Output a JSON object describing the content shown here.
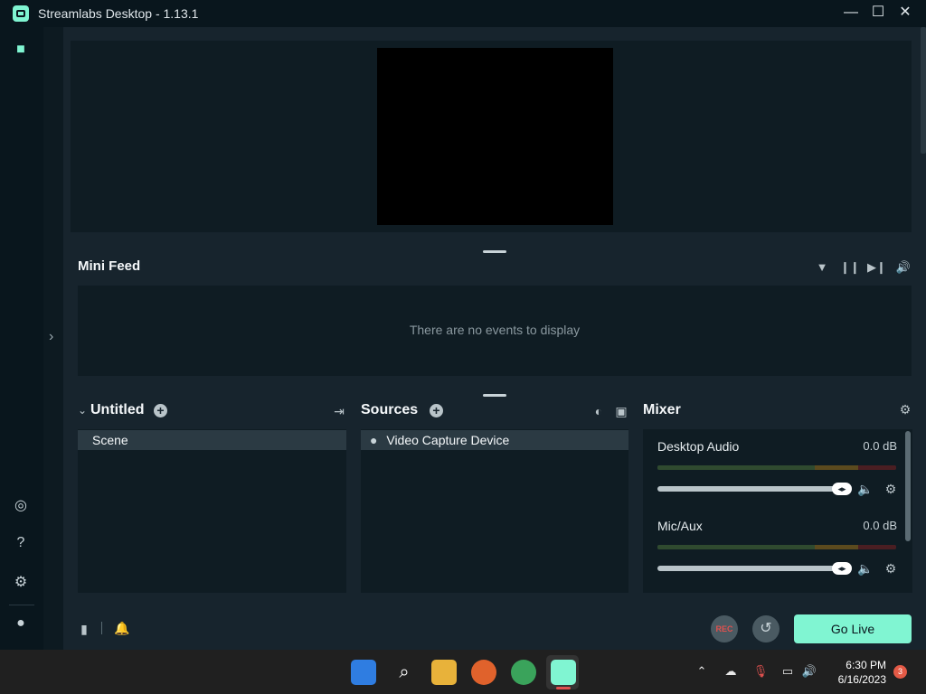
{
  "window": {
    "title": "Streamlabs Desktop - 1.13.1",
    "minimize": "—",
    "maximize": "☐",
    "close": "✕"
  },
  "minifeed": {
    "title": "Mini Feed",
    "empty_text": "There are no events to display"
  },
  "scenes": {
    "collection": "Untitled",
    "items": [
      "Scene"
    ]
  },
  "sources": {
    "title": "Sources",
    "items": [
      "Video Capture Device"
    ]
  },
  "mixer": {
    "title": "Mixer",
    "channels": [
      {
        "name": "Desktop Audio",
        "db": "0.0 dB",
        "volume": 1.0
      },
      {
        "name": "Mic/Aux",
        "db": "0.0 dB",
        "volume": 1.0
      }
    ]
  },
  "footer": {
    "rec_label": "REC",
    "go_live_label": "Go Live"
  },
  "taskbar": {
    "time": "6:30 PM",
    "date": "6/16/2023",
    "notifications": "3"
  },
  "colors": {
    "accent": "#80f5d2",
    "background": "#17242d",
    "panel": "#0f1c23",
    "rec": "#e0514f"
  }
}
